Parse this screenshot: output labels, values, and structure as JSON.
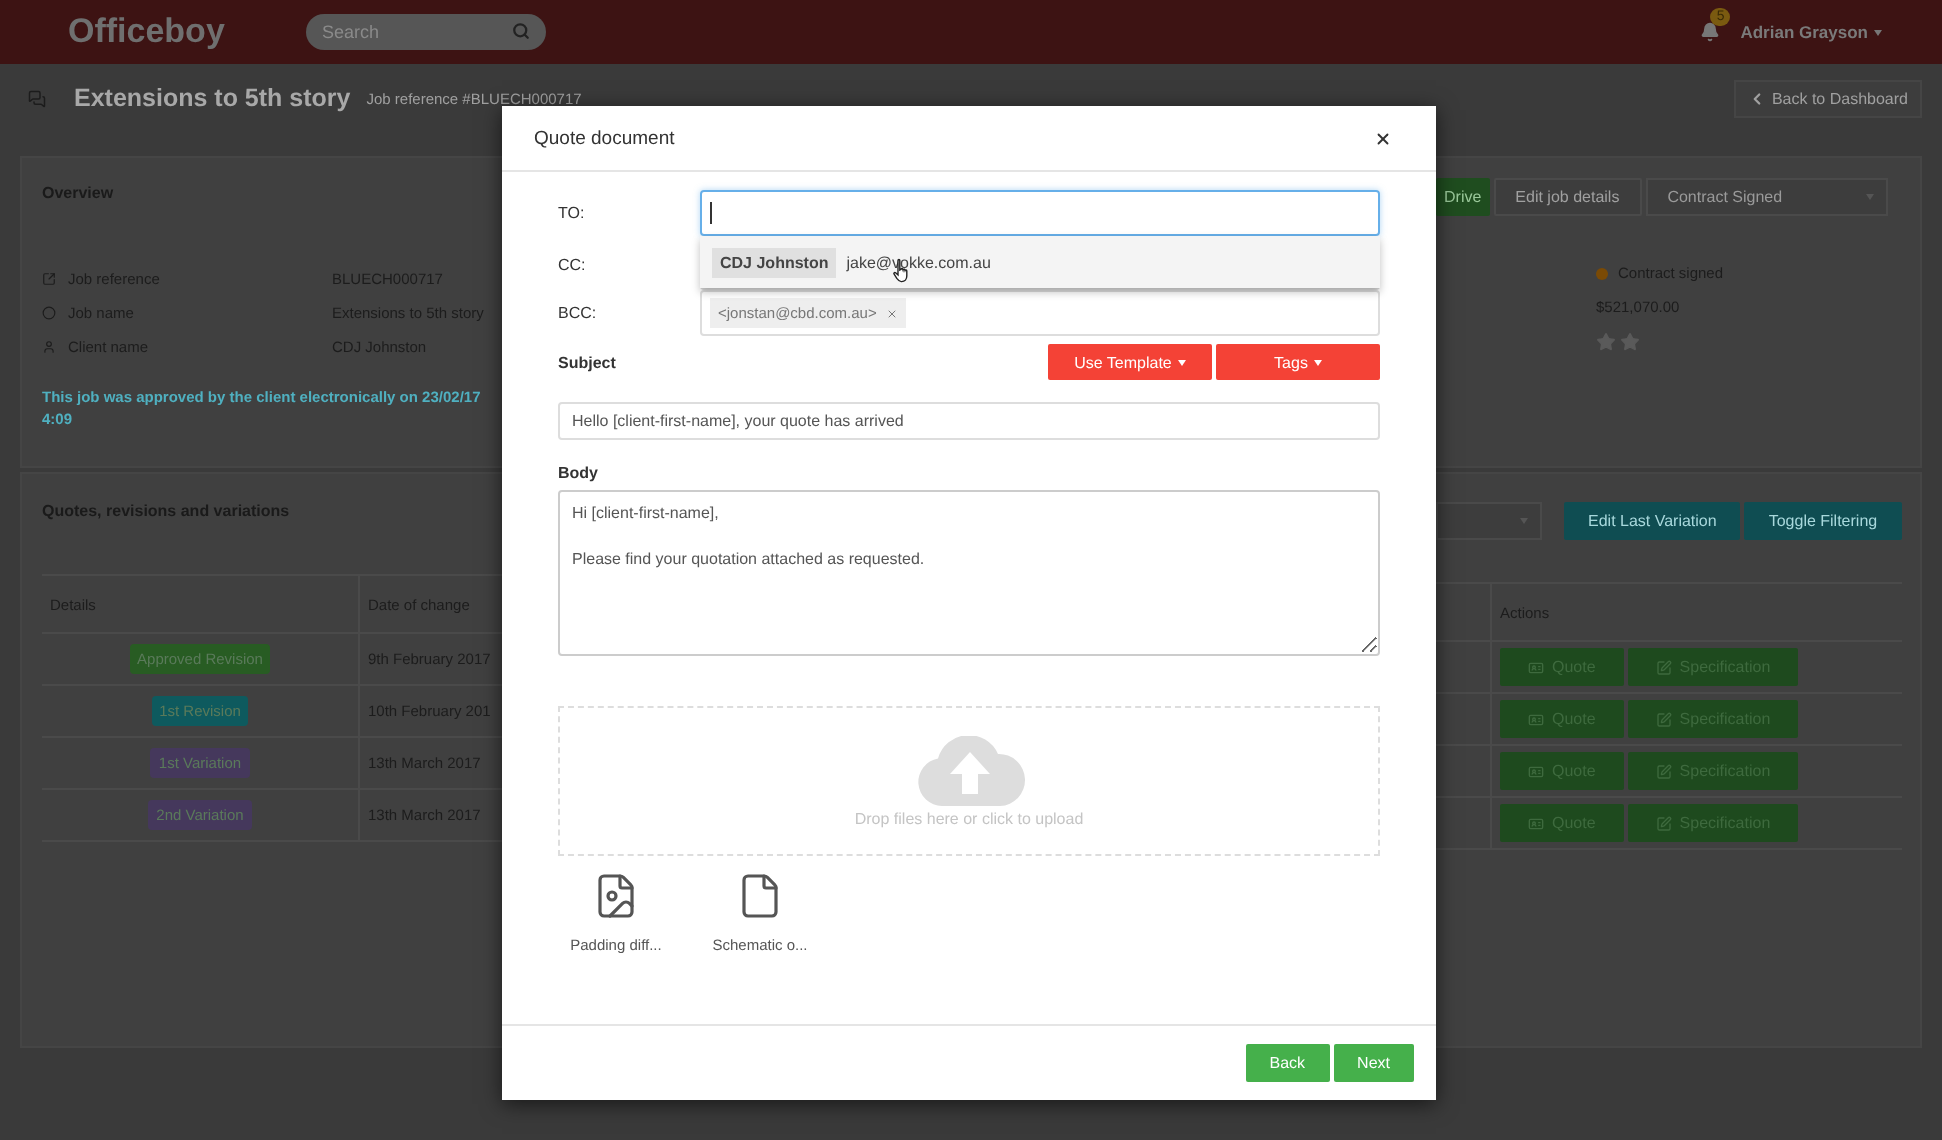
{
  "header": {
    "logo": "Officeboy",
    "search": {
      "placeholder": "Search"
    },
    "notifications": "5",
    "user": "Adrian Grayson"
  },
  "page": {
    "title": "Extensions to 5th story",
    "reference": "Job reference #BLUECH000717",
    "back_button": "Back to Dashboard"
  },
  "overview": {
    "title": "Overview",
    "buttons": [
      "Drive",
      "Edit job details"
    ],
    "status_select": "Contract Signed",
    "details": [
      {
        "label": "Job reference",
        "value": "BLUECH000717"
      },
      {
        "label": "Job name",
        "value": "Extensions to 5th story"
      },
      {
        "label": "Client name",
        "value": "CDJ Johnston"
      }
    ],
    "approval_note": "This job was approved by the client electronically on 23/02/17 4:09",
    "status": "Contract signed",
    "price": "$521,070.00"
  },
  "quotes": {
    "title": "Quotes, revisions and variations",
    "buttons": [
      "Edit Last Variation",
      "Toggle Filtering"
    ],
    "columns": [
      "Details",
      "Date of change",
      "Actions"
    ],
    "rows": [
      {
        "badge": "Approved Revision",
        "color": "#285c23",
        "date": "9th February 2017",
        "actions": [
          "Quote",
          "Specification"
        ]
      },
      {
        "badge": "1st Revision",
        "color": "#0e5a5e",
        "date": "10th February 201",
        "actions": [
          "Quote",
          "Specification"
        ]
      },
      {
        "badge": "1st Variation",
        "color": "#45385c",
        "date": "13th March 2017",
        "actions": [
          "Quote",
          "Specification"
        ]
      },
      {
        "badge": "2nd Variation",
        "color": "#45385c",
        "date": "13th March 2017",
        "actions": [
          "Quote",
          "Specification"
        ]
      }
    ]
  },
  "modal": {
    "title": "Quote document",
    "fields": [
      {
        "label": "TO:",
        "focused": true
      },
      {
        "label": "CC:",
        "focused": false
      },
      {
        "label": "BCC:",
        "focused": false,
        "tags": [
          "<jonstan@cbd.com.au>"
        ]
      }
    ],
    "suggestion": {
      "name": "CDJ Johnston",
      "email": "jake@vokke.com.au"
    },
    "subject": {
      "label": "Subject",
      "value": "Hello [client-first-name], your quote has arrived"
    },
    "menu_buttons": [
      "Use Template",
      "Tags"
    ],
    "body": {
      "label": "Body",
      "value": "Hi [client-first-name],\n\nPlease find your quotation attached as requested."
    },
    "dropzone": "Drop files here or click to upload",
    "files": [
      {
        "name": "Padding diff...",
        "kind": "image"
      },
      {
        "name": "Schematic o...",
        "kind": "document"
      }
    ],
    "buttons": [
      "Back",
      "Next"
    ]
  }
}
